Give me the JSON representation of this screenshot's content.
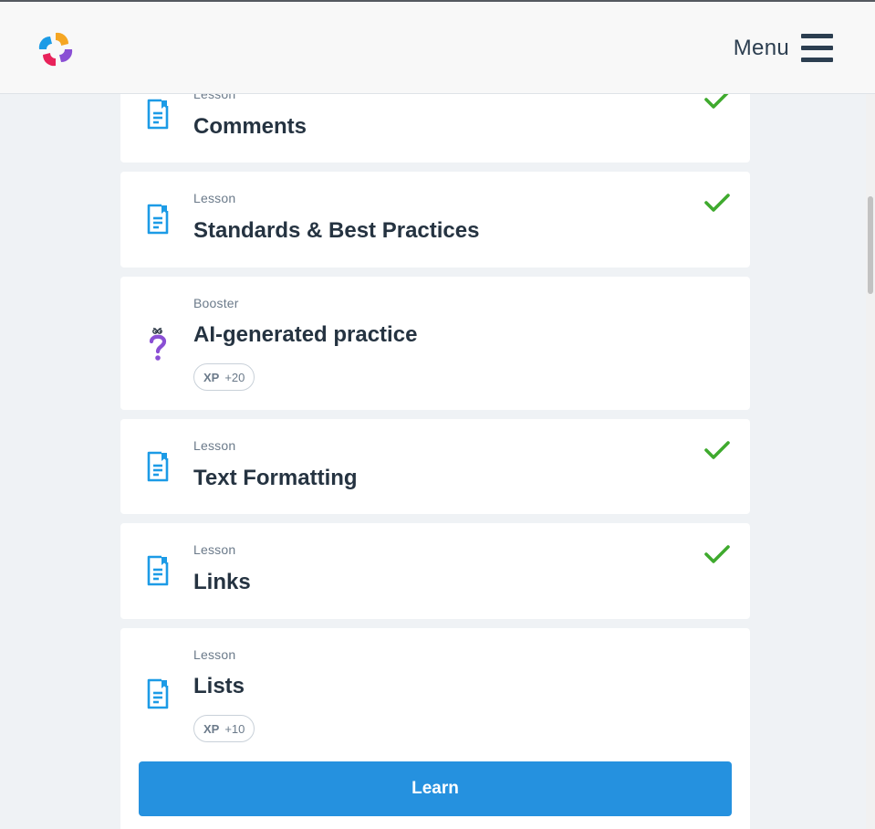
{
  "header": {
    "menu_label": "Menu"
  },
  "icons": {
    "lesson_icon": "document-icon",
    "booster_icon": "question-mark-icon",
    "completed_icon": "checkmark-icon"
  },
  "colors": {
    "accent_blue": "#2591df",
    "check_green": "#3faa2e",
    "booster_purple": "#8a4fd4",
    "icon_blue": "#1c9be6"
  },
  "items": [
    {
      "kind": "Lesson",
      "title": "Comments"
    },
    {
      "kind": "Lesson",
      "title": "Standards & Best Practices"
    },
    {
      "kind": "Booster",
      "title": "AI-generated practice",
      "xp_label": "XP",
      "xp_value": "+20"
    },
    {
      "kind": "Lesson",
      "title": "Text Formatting"
    },
    {
      "kind": "Lesson",
      "title": "Links"
    },
    {
      "kind": "Lesson",
      "title": "Lists",
      "xp_label": "XP",
      "xp_value": "+10",
      "button_label": "Learn"
    }
  ]
}
